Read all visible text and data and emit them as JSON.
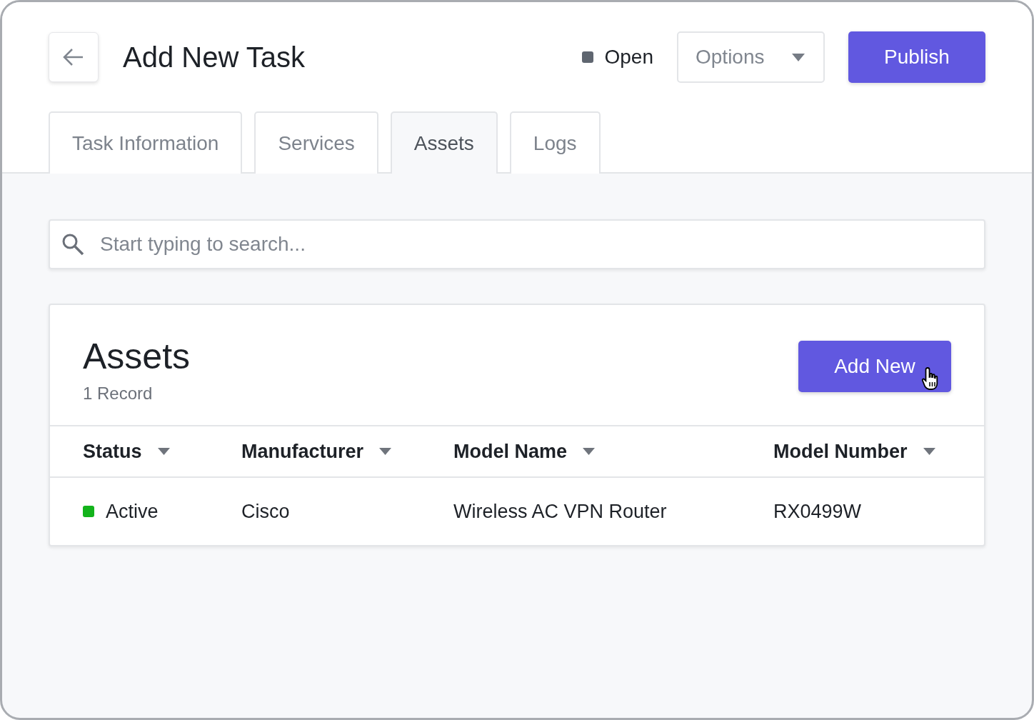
{
  "header": {
    "title": "Add New Task",
    "status": {
      "label": "Open",
      "color": "#5f6670"
    },
    "options": {
      "label": "Options"
    },
    "publish": {
      "label": "Publish"
    }
  },
  "tabs": [
    {
      "label": "Task Information",
      "selected": false
    },
    {
      "label": "Services",
      "selected": false
    },
    {
      "label": "Assets",
      "selected": true
    },
    {
      "label": "Logs",
      "selected": false
    }
  ],
  "search": {
    "placeholder": "Start typing to search..."
  },
  "card": {
    "title": "Assets",
    "count": "1 Record",
    "add_button": "Add New",
    "table": {
      "columns": [
        "Status",
        "Manufacturer",
        "Model Name",
        "Model Number"
      ],
      "rows": [
        {
          "color": "#13b31b",
          "cells": [
            "Active",
            "Cisco",
            "Wireless AC VPN Router",
            "RX0499W"
          ]
        }
      ]
    }
  }
}
